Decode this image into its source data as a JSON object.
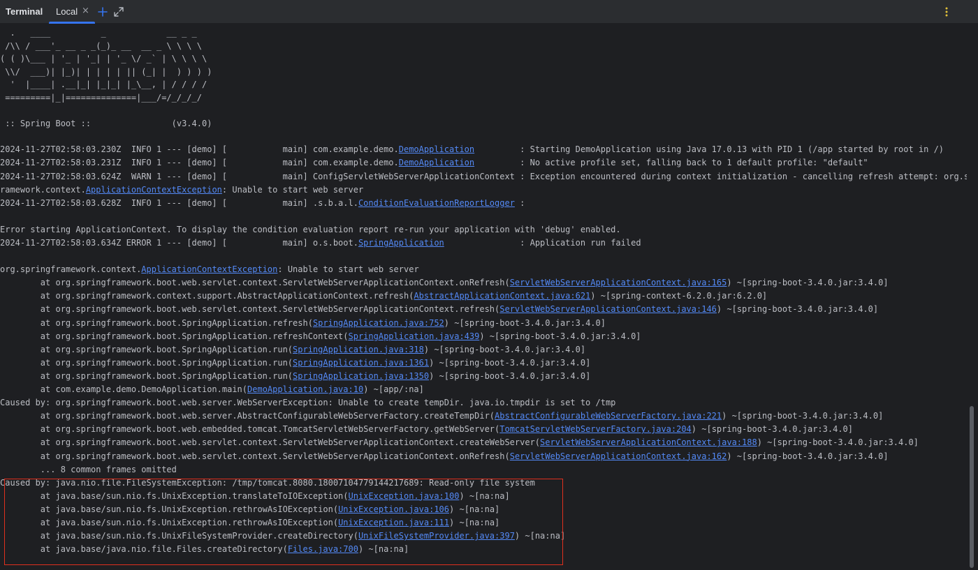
{
  "window": {
    "title": "Terminal",
    "tab_label": "Local",
    "close_glyph": "×",
    "icons": [
      "add-tab-icon",
      "maximize-icon",
      "more-options-icon"
    ]
  },
  "banner": [
    "  .   ____          _            __ _ _",
    " /\\\\ / ___'_ __ _ _(_)_ __  __ _ \\ \\ \\ \\",
    "( ( )\\___ | '_ | '_| | '_ \\/ _` | \\ \\ \\ \\",
    " \\\\/  ___)| |_)| | | | | || (_| |  ) ) ) )",
    "  '  |____| .__|_| |_|_| |_\\__, | / / / /",
    " =========|_|==============|___/=/_/_/_/",
    "",
    " :: Spring Boot ::                (v3.4.0)",
    ""
  ],
  "log": [
    [
      {
        "t": "2024-11-27T02:58:03.230Z  INFO 1 --- [demo] [           main] com.example.demo."
      },
      {
        "t": "DemoApplication",
        "link": true
      },
      {
        "t": "         : Starting DemoApplication using Java 17.0.13 with PID 1 (/app started by root in /)"
      }
    ],
    [
      {
        "t": "2024-11-27T02:58:03.231Z  INFO 1 --- [demo] [           main] com.example.demo."
      },
      {
        "t": "DemoApplication",
        "link": true
      },
      {
        "t": "         : No active profile set, falling back to 1 default profile: \"default\""
      }
    ],
    [
      {
        "t": "2024-11-27T02:58:03.624Z  WARN 1 --- [demo] [           main] ConfigServletWebServerApplicationContext : Exception encountered during context initialization - cancelling refresh attempt: org.springf"
      }
    ],
    [
      {
        "t": "ramework.context."
      },
      {
        "t": "ApplicationContextException",
        "link": true
      },
      {
        "t": ": Unable to start web server"
      }
    ],
    [
      {
        "t": "2024-11-27T02:58:03.628Z  INFO 1 --- [demo] [           main] .s.b.a.l."
      },
      {
        "t": "ConditionEvaluationReportLogger",
        "link": true
      },
      {
        "t": " :"
      }
    ],
    [
      {
        "t": ""
      }
    ],
    [
      {
        "t": "Error starting ApplicationContext. To display the condition evaluation report re-run your application with 'debug' enabled."
      }
    ],
    [
      {
        "t": "2024-11-27T02:58:03.634Z ERROR 1 --- [demo] [           main] o.s.boot."
      },
      {
        "t": "SpringApplication",
        "link": true
      },
      {
        "t": "               : Application run failed"
      }
    ],
    [
      {
        "t": ""
      }
    ],
    [
      {
        "t": "org.springframework.context."
      },
      {
        "t": "ApplicationContextException",
        "link": true
      },
      {
        "t": ": Unable to start web server"
      }
    ],
    [
      {
        "t": "        at org.springframework.boot.web.servlet.context.ServletWebServerApplicationContext.onRefresh("
      },
      {
        "t": "ServletWebServerApplicationContext.java:165",
        "link": true
      },
      {
        "t": ") ~[spring-boot-3.4.0.jar:3.4.0]"
      }
    ],
    [
      {
        "t": "        at org.springframework.context.support.AbstractApplicationContext.refresh("
      },
      {
        "t": "AbstractApplicationContext.java:621",
        "link": true
      },
      {
        "t": ") ~[spring-context-6.2.0.jar:6.2.0]"
      }
    ],
    [
      {
        "t": "        at org.springframework.boot.web.servlet.context.ServletWebServerApplicationContext.refresh("
      },
      {
        "t": "ServletWebServerApplicationContext.java:146",
        "link": true
      },
      {
        "t": ") ~[spring-boot-3.4.0.jar:3.4.0]"
      }
    ],
    [
      {
        "t": "        at org.springframework.boot.SpringApplication.refresh("
      },
      {
        "t": "SpringApplication.java:752",
        "link": true
      },
      {
        "t": ") ~[spring-boot-3.4.0.jar:3.4.0]"
      }
    ],
    [
      {
        "t": "        at org.springframework.boot.SpringApplication.refreshContext("
      },
      {
        "t": "SpringApplication.java:439",
        "link": true
      },
      {
        "t": ") ~[spring-boot-3.4.0.jar:3.4.0]"
      }
    ],
    [
      {
        "t": "        at org.springframework.boot.SpringApplication.run("
      },
      {
        "t": "SpringApplication.java:318",
        "link": true
      },
      {
        "t": ") ~[spring-boot-3.4.0.jar:3.4.0]"
      }
    ],
    [
      {
        "t": "        at org.springframework.boot.SpringApplication.run("
      },
      {
        "t": "SpringApplication.java:1361",
        "link": true
      },
      {
        "t": ") ~[spring-boot-3.4.0.jar:3.4.0]"
      }
    ],
    [
      {
        "t": "        at org.springframework.boot.SpringApplication.run("
      },
      {
        "t": "SpringApplication.java:1350",
        "link": true
      },
      {
        "t": ") ~[spring-boot-3.4.0.jar:3.4.0]"
      }
    ],
    [
      {
        "t": "        at com.example.demo.DemoApplication.main("
      },
      {
        "t": "DemoApplication.java:10",
        "link": true
      },
      {
        "t": ") ~[app/:na]"
      }
    ],
    [
      {
        "t": "Caused by: org.springframework.boot.web.server.WebServerException: Unable to create tempDir. java.io.tmpdir is set to /tmp"
      }
    ],
    [
      {
        "t": "        at org.springframework.boot.web.server.AbstractConfigurableWebServerFactory.createTempDir("
      },
      {
        "t": "AbstractConfigurableWebServerFactory.java:221",
        "link": true
      },
      {
        "t": ") ~[spring-boot-3.4.0.jar:3.4.0]"
      }
    ],
    [
      {
        "t": "        at org.springframework.boot.web.embedded.tomcat.TomcatServletWebServerFactory.getWebServer("
      },
      {
        "t": "TomcatServletWebServerFactory.java:204",
        "link": true
      },
      {
        "t": ") ~[spring-boot-3.4.0.jar:3.4.0]"
      }
    ],
    [
      {
        "t": "        at org.springframework.boot.web.servlet.context.ServletWebServerApplicationContext.createWebServer("
      },
      {
        "t": "ServletWebServerApplicationContext.java:188",
        "link": true
      },
      {
        "t": ") ~[spring-boot-3.4.0.jar:3.4.0]"
      }
    ],
    [
      {
        "t": "        at org.springframework.boot.web.servlet.context.ServletWebServerApplicationContext.onRefresh("
      },
      {
        "t": "ServletWebServerApplicationContext.java:162",
        "link": true
      },
      {
        "t": ") ~[spring-boot-3.4.0.jar:3.4.0]"
      }
    ],
    [
      {
        "t": "        ... 8 common frames omitted"
      }
    ],
    [
      {
        "t": "Caused by: java.nio.file.FileSystemException: /tmp/tomcat.8080.18007104779144217689: Read-only file system"
      }
    ],
    [
      {
        "t": "        at java.base/sun.nio.fs.UnixException.translateToIOException("
      },
      {
        "t": "UnixException.java:100",
        "link": true
      },
      {
        "t": ") ~[na:na]"
      }
    ],
    [
      {
        "t": "        at java.base/sun.nio.fs.UnixException.rethrowAsIOException("
      },
      {
        "t": "UnixException.java:106",
        "link": true
      },
      {
        "t": ") ~[na:na]"
      }
    ],
    [
      {
        "t": "        at java.base/sun.nio.fs.UnixException.rethrowAsIOException("
      },
      {
        "t": "UnixException.java:111",
        "link": true
      },
      {
        "t": ") ~[na:na]"
      }
    ],
    [
      {
        "t": "        at java.base/sun.nio.fs.UnixFileSystemProvider.createDirectory("
      },
      {
        "t": "UnixFileSystemProvider.java:397",
        "link": true
      },
      {
        "t": ") ~[na:na]"
      }
    ],
    [
      {
        "t": "        at java.base/java.nio.file.Files.createDirectory("
      },
      {
        "t": "Files.java:700",
        "link": true
      },
      {
        "t": ") ~[na:na]"
      }
    ]
  ],
  "colors": {
    "background": "#1e1f22",
    "header": "#2b2d30",
    "text": "#bcbec4",
    "link": "#548af7",
    "accent": "#3574f0",
    "highlight_border": "#e0301e"
  }
}
